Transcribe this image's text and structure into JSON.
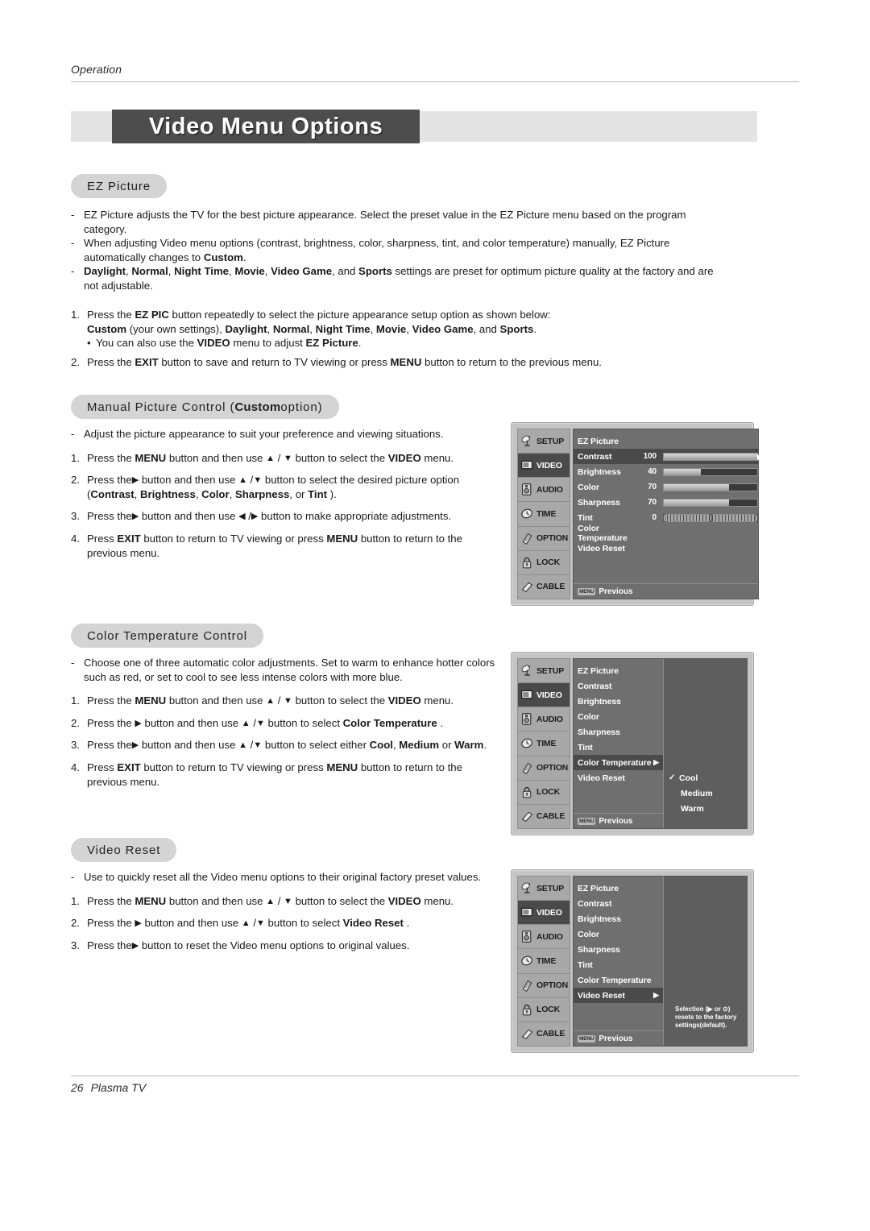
{
  "header": {
    "running_head": "Operation"
  },
  "title": {
    "text": "Video Menu Options"
  },
  "footer": {
    "page_number": "26",
    "product": "Plasma TV"
  },
  "sections": {
    "ez_picture": {
      "heading": "EZ Picture",
      "bullets": [
        "EZ Picture adjusts the TV for the best picture appearance. Select the preset value in the EZ Picture menu based on the program category.",
        "When adjusting Video menu options (contrast, brightness, color, sharpness, tint, and color temperature) manually, EZ Picture automatically changes to Custom.",
        "Daylight, Normal, Night Time, Movie, Video Game, and Sports settings are preset for optimum picture quality at the factory and are not adjustable."
      ],
      "step1_a": "Press the EZ PIC button repeatedly to select the picture appearance setup option as shown below:",
      "step1_b": "Custom (your own settings), Daylight, Normal, Night Time, Movie, Video Game, and Sports.",
      "step1_sub": "You can also use the VIDEO menu to adjust EZ Picture.",
      "step2": "Press the EXIT button to save and return to TV viewing or press MENU button to return to the previous menu."
    },
    "manual_picture": {
      "heading_a": "Manual Picture Control (",
      "heading_b": "Custom",
      "heading_c": " option)",
      "bullet": "Adjust the picture appearance to suit your preference and viewing situations.",
      "step1": "Press the MENU button and then use ▲ / ▼ button to select the VIDEO menu.",
      "step2_a": "Press the ▶ button and then use ▲ / ▼ button to select the desired picture option",
      "step2_b": "(Contrast, Brightness, Color, Sharpness, or Tint ).",
      "step3": "Press the ▶ button and then use ◀ / ▶ button to make appropriate adjustments.",
      "step4": "Press EXIT button to return to TV viewing or press MENU button to return to the previous menu."
    },
    "color_temperature": {
      "heading": "Color Temperature Control",
      "bullet": "Choose one of three automatic color adjustments. Set to warm to enhance hotter colors such as red, or set to cool to see less intense colors with more blue.",
      "step1": "Press the MENU button and then use ▲ / ▼ button to select the VIDEO menu.",
      "step2": "Press the ▶ button and then use ▲ / ▼ button to select Color Temperature .",
      "step3_a": "Press the ▶ button and then use ▲ / ▼ button to select either Cool, Medium or",
      "step3_b": "Warm.",
      "step4": "Press EXIT button to return to TV viewing or press MENU button to return to the previous menu."
    },
    "video_reset": {
      "heading": "Video Reset",
      "bullet": "Use to quickly reset all the Video menu options to their original factory preset values.",
      "step1": "Press the MENU button and then use ▲ / ▼ button to select the VIDEO menu.",
      "step2": "Press the ▶ button and then use ▲ / ▼ button to select Video Reset .",
      "step3": "Press the ▶ button to reset the Video menu options to original values."
    }
  },
  "osd": {
    "sidebar": [
      {
        "label": "SETUP",
        "icon": "satellite-dish-icon",
        "selected": false
      },
      {
        "label": "VIDEO",
        "icon": "monitor-icon",
        "selected": true
      },
      {
        "label": "AUDIO",
        "icon": "speaker-icon",
        "selected": false
      },
      {
        "label": "TIME",
        "icon": "clock-icon",
        "selected": false
      },
      {
        "label": "OPTION",
        "icon": "hand-icon",
        "selected": false
      },
      {
        "label": "LOCK",
        "icon": "padlock-icon",
        "selected": false
      },
      {
        "label": "CABLE",
        "icon": "cable-plug-icon",
        "selected": false
      }
    ],
    "footer_key": "MENU",
    "footer_label": "Previous",
    "screen1": {
      "caption": "Manual Picture Control menu",
      "rows": [
        {
          "name": "EZ Picture",
          "value": "",
          "bar": "none",
          "fill": 0,
          "highlight": false
        },
        {
          "name": "Contrast",
          "value": "100",
          "bar": "solid",
          "fill": 100,
          "highlight": true
        },
        {
          "name": "Brightness",
          "value": "40",
          "bar": "solid",
          "fill": 40,
          "highlight": false
        },
        {
          "name": "Color",
          "value": "70",
          "bar": "solid",
          "fill": 70,
          "highlight": false
        },
        {
          "name": "Sharpness",
          "value": "70",
          "bar": "solid",
          "fill": 70,
          "highlight": false
        },
        {
          "name": "Tint",
          "value": "0",
          "bar": "tick",
          "fill": 50,
          "highlight": false
        },
        {
          "name": "Color Temperature",
          "value": "",
          "bar": "none",
          "fill": 0,
          "highlight": false
        },
        {
          "name": "Video Reset",
          "value": "",
          "bar": "none",
          "fill": 0,
          "highlight": false
        }
      ]
    },
    "screen2": {
      "caption": "Color Temperature submenu",
      "rows": [
        {
          "name": "EZ Picture",
          "highlight": false,
          "caret": ""
        },
        {
          "name": "Contrast",
          "highlight": false,
          "caret": ""
        },
        {
          "name": "Brightness",
          "highlight": false,
          "caret": ""
        },
        {
          "name": "Color",
          "highlight": false,
          "caret": ""
        },
        {
          "name": "Sharpness",
          "highlight": false,
          "caret": ""
        },
        {
          "name": "Tint",
          "highlight": false,
          "caret": ""
        },
        {
          "name": "Color Temperature",
          "highlight": true,
          "caret": "▶"
        },
        {
          "name": "Video Reset",
          "highlight": false,
          "caret": ""
        }
      ],
      "options": [
        {
          "label": "Cool",
          "checked": true
        },
        {
          "label": "Medium",
          "checked": false
        },
        {
          "label": "Warm",
          "checked": false
        }
      ]
    },
    "screen3": {
      "caption": "Video Reset submenu",
      "rows": [
        {
          "name": "EZ Picture",
          "highlight": false,
          "caret": ""
        },
        {
          "name": "Contrast",
          "highlight": false,
          "caret": ""
        },
        {
          "name": "Brightness",
          "highlight": false,
          "caret": ""
        },
        {
          "name": "Color",
          "highlight": false,
          "caret": ""
        },
        {
          "name": "Sharpness",
          "highlight": false,
          "caret": ""
        },
        {
          "name": "Tint",
          "highlight": false,
          "caret": ""
        },
        {
          "name": "Color Temperature",
          "highlight": false,
          "caret": ""
        },
        {
          "name": "Video Reset",
          "highlight": true,
          "caret": "▶"
        }
      ],
      "hint": "Selection (▶ or ⊙) resets to the factory settings(default)."
    }
  }
}
